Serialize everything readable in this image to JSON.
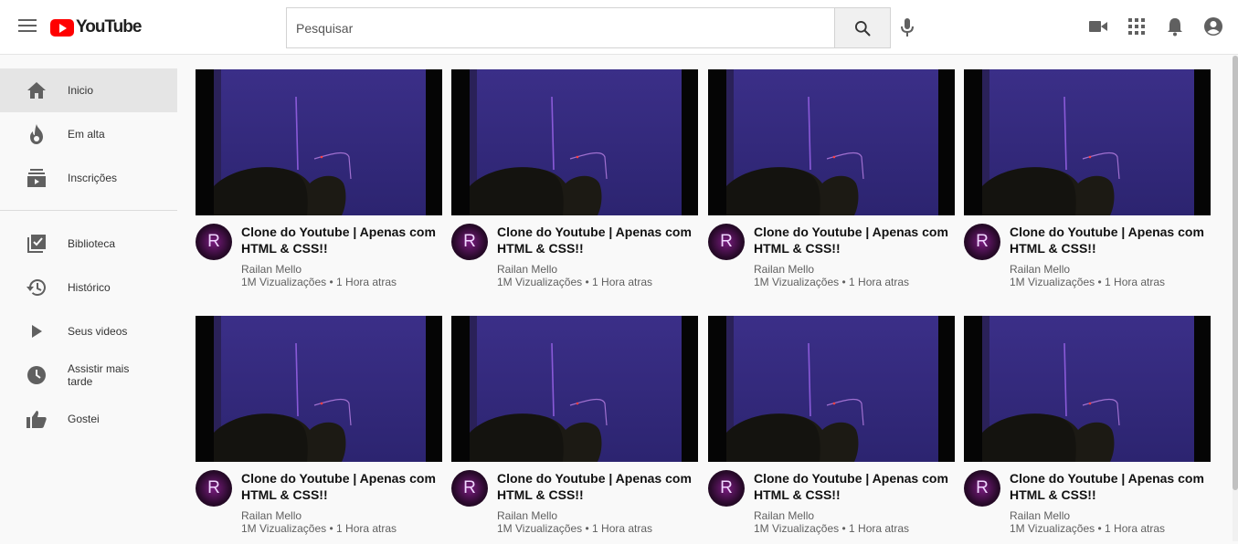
{
  "header": {
    "logo_text": "YouTube",
    "search_placeholder": "Pesquisar",
    "icons": [
      "menu-icon",
      "search-icon",
      "mic-icon",
      "video-camera-icon",
      "apps-grid-icon",
      "bell-icon",
      "account-icon"
    ]
  },
  "sidebar": {
    "items": [
      {
        "label": "Inicio",
        "icon": "home-icon",
        "active": true
      },
      {
        "label": "Em alta",
        "icon": "fire-icon"
      },
      {
        "label": "Inscrições",
        "icon": "subscriptions-icon"
      },
      {
        "label": "Biblioteca",
        "icon": "library-icon"
      },
      {
        "label": "Histórico",
        "icon": "history-icon"
      },
      {
        "label": "Seus videos",
        "icon": "play-icon"
      },
      {
        "label": "Assistir mais tarde",
        "icon": "clock-icon"
      },
      {
        "label": "Gostei",
        "icon": "thumbs-up-icon"
      }
    ]
  },
  "videos": [
    {
      "title": "Clone do Youtube | Apenas com HTML & CSS!!",
      "channel": "Railan Mello",
      "meta": "1M Vizualizações • 1 Hora atras",
      "avatar_letter": "R"
    },
    {
      "title": "Clone do Youtube | Apenas com HTML & CSS!!",
      "channel": "Railan Mello",
      "meta": "1M Vizualizações • 1 Hora atras",
      "avatar_letter": "R"
    },
    {
      "title": "Clone do Youtube | Apenas com HTML & CSS!!",
      "channel": "Railan Mello",
      "meta": "1M Vizualizações • 1 Hora atras",
      "avatar_letter": "R"
    },
    {
      "title": "Clone do Youtube | Apenas com HTML & CSS!!",
      "channel": "Railan Mello",
      "meta": "1M Vizualizações • 1 Hora atras",
      "avatar_letter": "R"
    },
    {
      "title": "Clone do Youtube | Apenas com HTML & CSS!!",
      "channel": "Railan Mello",
      "meta": "1M Vizualizações • 1 Hora atras",
      "avatar_letter": "R"
    },
    {
      "title": "Clone do Youtube | Apenas com HTML & CSS!!",
      "channel": "Railan Mello",
      "meta": "1M Vizualizações • 1 Hora atras",
      "avatar_letter": "R"
    },
    {
      "title": "Clone do Youtube | Apenas com HTML & CSS!!",
      "channel": "Railan Mello",
      "meta": "1M Vizualizações • 1 Hora atras",
      "avatar_letter": "R"
    },
    {
      "title": "Clone do Youtube | Apenas com HTML & CSS!!",
      "channel": "Railan Mello",
      "meta": "1M Vizualizações • 1 Hora atras",
      "avatar_letter": "R"
    }
  ],
  "colors": {
    "brand": "#ff0000",
    "thumbnail_tint": "#3a2a8c",
    "background": "#f9f9f9"
  }
}
